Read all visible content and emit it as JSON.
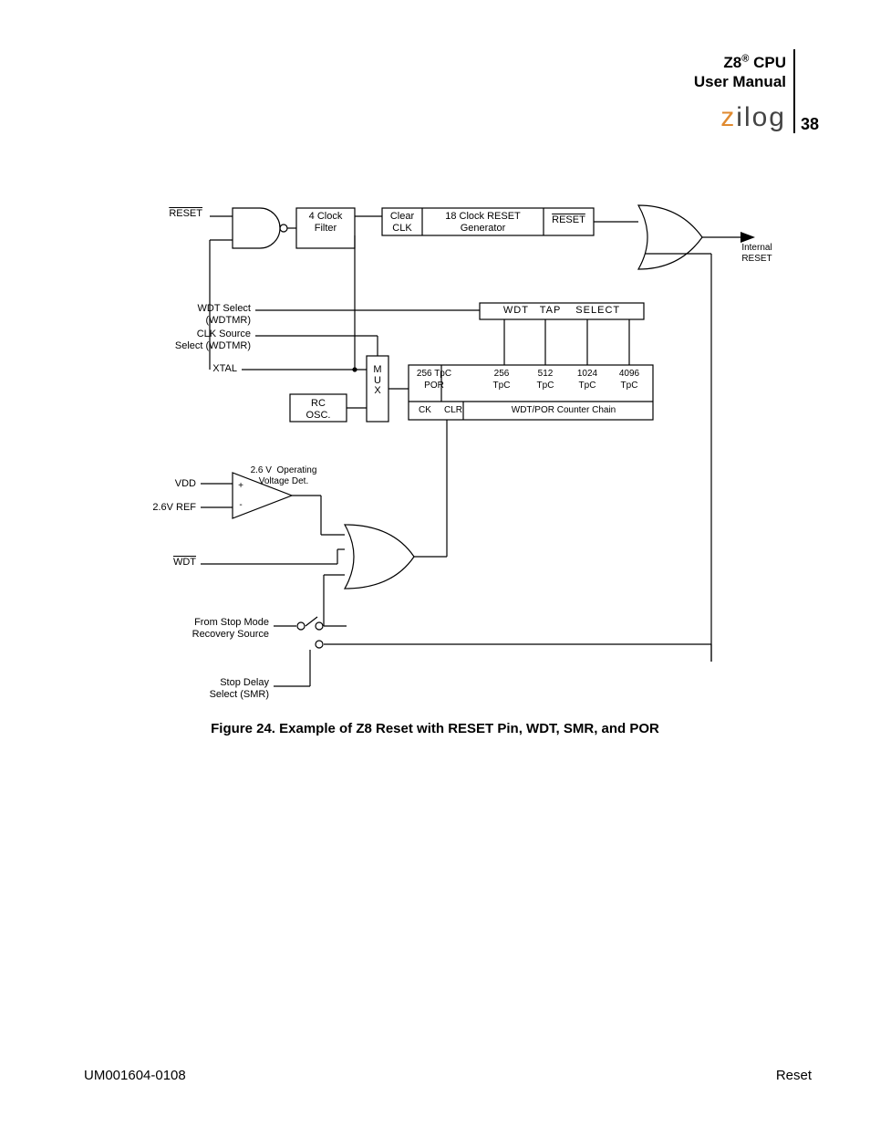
{
  "header": {
    "line1_a": "Z8",
    "line1_sup": "®",
    "line1_b": " CPU",
    "line2": "User Manual",
    "logo_z": "z",
    "logo_rest": "ilog",
    "page_num": "38"
  },
  "caption": "Figure 24. Example of Z8 Reset with RESET Pin, WDT, SMR, and POR",
  "footer": {
    "left": "UM001604-0108",
    "right": "Reset"
  },
  "diagram": {
    "signals": {
      "reset_in": "RESET",
      "wdt_select": "WDT Select\n(WDTMR)",
      "clk_source": "CLK Source\nSelect (WDTMR)",
      "xtal": "XTAL",
      "vdd": "VDD",
      "ref26": "2.6V REF",
      "wdt": "WDT",
      "stop_src": "From Stop Mode\nRecovery Source",
      "stop_delay": "Stop Delay\nSelect (SMR)",
      "internal_reset": "Internal\nRESET"
    },
    "blocks": {
      "filter": "4 Clock\nFilter",
      "clear_clk": "Clear\nCLK",
      "reset_gen": "18 Clock RESET\nGenerator",
      "reset_out": "RESET",
      "mux": "M\nU\nX",
      "rc_osc": "RC\nOSC.",
      "tap_select": "WDT   TAP    SELECT",
      "counter_left_ck": "CK",
      "counter_left_clr": "CLR",
      "counter_right": "WDT/POR Counter Chain",
      "tap0a": "256 TpC",
      "tap0b": "POR",
      "tap1a": "256",
      "tap1b": "TpC",
      "tap2a": "512",
      "tap2b": "TpC",
      "tap3a": "1024",
      "tap3b": "TpC",
      "tap4a": "4096",
      "tap4b": "TpC",
      "comp": "2.6 V  Operating\nVoltage Det.",
      "plus": "+",
      "minus": "-"
    }
  }
}
